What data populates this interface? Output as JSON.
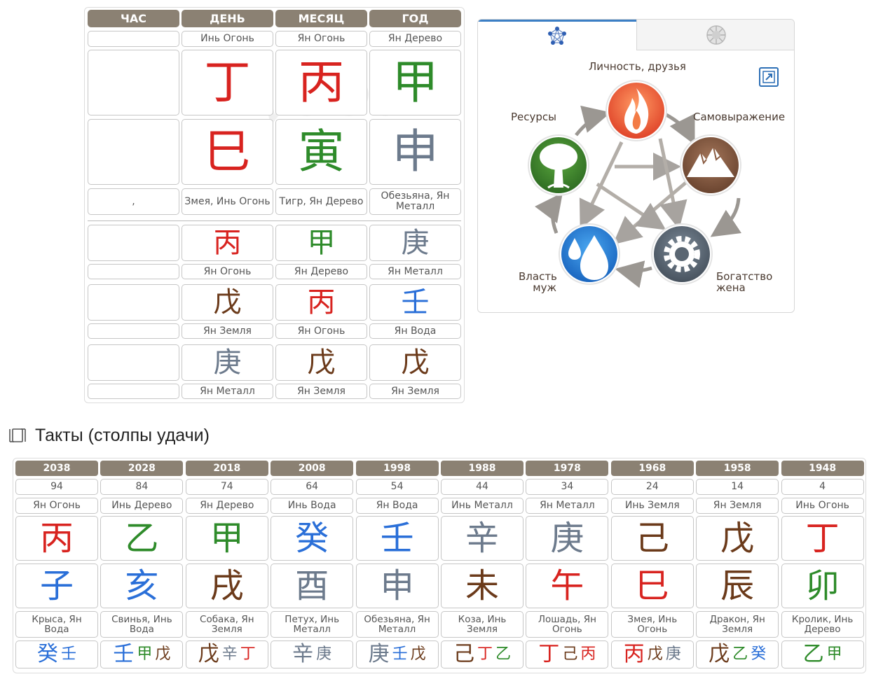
{
  "colors": {
    "fire": "#d8231f",
    "wood": "#2e8b2a",
    "earth": "#6b3a1a",
    "metal": "#6c7a8c",
    "water": "#2a6fd8",
    "header": "#8b8173"
  },
  "chart": {
    "headers": [
      "ЧАС",
      "ДЕНЬ",
      "МЕСЯЦ",
      "ГОД"
    ],
    "columns": [
      {
        "stem_label": "",
        "stem": "",
        "stem_el": "",
        "branch": "",
        "branch_el": "",
        "branch_label": ",",
        "hidden": [
          {
            "char": "",
            "el": "",
            "label": ""
          },
          {
            "char": "",
            "el": "",
            "label": ""
          },
          {
            "char": "",
            "el": "",
            "label": ""
          }
        ]
      },
      {
        "stem_label": "Инь Огонь",
        "stem": "丁",
        "stem_el": "fire",
        "branch": "巳",
        "branch_el": "fire",
        "branch_label": "Змея, Инь Огонь",
        "hidden": [
          {
            "char": "丙",
            "el": "fire",
            "label": "Ян Огонь"
          },
          {
            "char": "戊",
            "el": "earth",
            "label": "Ян Земля"
          },
          {
            "char": "庚",
            "el": "metal",
            "label": "Ян Металл"
          }
        ]
      },
      {
        "stem_label": "Ян Огонь",
        "stem": "丙",
        "stem_el": "fire",
        "branch": "寅",
        "branch_el": "wood",
        "branch_label": "Тигр, Ян Дерево",
        "hidden": [
          {
            "char": "甲",
            "el": "wood",
            "label": "Ян Дерево"
          },
          {
            "char": "丙",
            "el": "fire",
            "label": "Ян Огонь"
          },
          {
            "char": "戊",
            "el": "earth",
            "label": "Ян Земля"
          }
        ]
      },
      {
        "stem_label": "Ян Дерево",
        "stem": "甲",
        "stem_el": "wood",
        "branch": "申",
        "branch_el": "metal",
        "branch_label": "Обезьяна, Ян Металл",
        "hidden": [
          {
            "char": "庚",
            "el": "metal",
            "label": "Ян Металл"
          },
          {
            "char": "壬",
            "el": "water",
            "label": "Ян Вода"
          },
          {
            "char": "戊",
            "el": "earth",
            "label": "Ян Земля"
          }
        ]
      }
    ]
  },
  "diagram": {
    "labels": {
      "top": "Личность, друзья",
      "right": "Самовыражение",
      "left": "Ресурсы",
      "bottom_left_1": "Власть",
      "bottom_left_2": "муж",
      "bottom_right_1": "Богатство",
      "bottom_right_2": "жена"
    },
    "icons": {
      "tab_a": "pentagon-network-icon",
      "tab_b": "circle-diagram-icon",
      "expand": "expand-icon",
      "fire": "fire-icon",
      "earth": "mountain-icon",
      "metal": "gear-icon",
      "water": "water-drops-icon",
      "wood": "tree-icon"
    }
  },
  "section": {
    "title": "Такты (столпы удачи)",
    "icon": "pillars-toggle-icon"
  },
  "luck": {
    "pillars": [
      {
        "year": "2038",
        "age": "94",
        "stem_label": "Ян Огонь",
        "stem": "丙",
        "stem_el": "fire",
        "branch": "子",
        "branch_el": "water",
        "branch_label": "Крыса, Ян Вода",
        "hidden": [
          {
            "c": "癸",
            "el": "water"
          },
          {
            "c": "壬",
            "el": "water"
          }
        ]
      },
      {
        "year": "2028",
        "age": "84",
        "stem_label": "Инь Дерево",
        "stem": "乙",
        "stem_el": "wood",
        "branch": "亥",
        "branch_el": "water",
        "branch_label": "Свинья, Инь Вода",
        "hidden": [
          {
            "c": "壬",
            "el": "water"
          },
          {
            "c": "甲",
            "el": "wood"
          },
          {
            "c": "戊",
            "el": "earth"
          }
        ]
      },
      {
        "year": "2018",
        "age": "74",
        "stem_label": "Ян Дерево",
        "stem": "甲",
        "stem_el": "wood",
        "branch": "戌",
        "branch_el": "earth",
        "branch_label": "Собака, Ян Земля",
        "hidden": [
          {
            "c": "戊",
            "el": "earth"
          },
          {
            "c": "辛",
            "el": "metal"
          },
          {
            "c": "丁",
            "el": "fire"
          }
        ]
      },
      {
        "year": "2008",
        "age": "64",
        "stem_label": "Инь Вода",
        "stem": "癸",
        "stem_el": "water",
        "branch": "酉",
        "branch_el": "metal",
        "branch_label": "Петух, Инь Металл",
        "hidden": [
          {
            "c": "辛",
            "el": "metal"
          },
          {
            "c": "庚",
            "el": "metal"
          }
        ]
      },
      {
        "year": "1998",
        "age": "54",
        "stem_label": "Ян Вода",
        "stem": "壬",
        "stem_el": "water",
        "branch": "申",
        "branch_el": "metal",
        "branch_label": "Обезьяна, Ян Металл",
        "hidden": [
          {
            "c": "庚",
            "el": "metal"
          },
          {
            "c": "壬",
            "el": "water"
          },
          {
            "c": "戊",
            "el": "earth"
          }
        ]
      },
      {
        "year": "1988",
        "age": "44",
        "stem_label": "Инь Металл",
        "stem": "辛",
        "stem_el": "metal",
        "branch": "未",
        "branch_el": "earth",
        "branch_label": "Коза, Инь Земля",
        "hidden": [
          {
            "c": "己",
            "el": "earth"
          },
          {
            "c": "丁",
            "el": "fire"
          },
          {
            "c": "乙",
            "el": "wood"
          }
        ]
      },
      {
        "year": "1978",
        "age": "34",
        "stem_label": "Ян Металл",
        "stem": "庚",
        "stem_el": "metal",
        "branch": "午",
        "branch_el": "fire",
        "branch_label": "Лошадь, Ян Огонь",
        "hidden": [
          {
            "c": "丁",
            "el": "fire"
          },
          {
            "c": "己",
            "el": "earth"
          },
          {
            "c": "丙",
            "el": "fire"
          }
        ]
      },
      {
        "year": "1968",
        "age": "24",
        "stem_label": "Инь Земля",
        "stem": "己",
        "stem_el": "earth",
        "branch": "巳",
        "branch_el": "fire",
        "branch_label": "Змея, Инь Огонь",
        "hidden": [
          {
            "c": "丙",
            "el": "fire"
          },
          {
            "c": "戊",
            "el": "earth"
          },
          {
            "c": "庚",
            "el": "metal"
          }
        ]
      },
      {
        "year": "1958",
        "age": "14",
        "stem_label": "Ян Земля",
        "stem": "戊",
        "stem_el": "earth",
        "branch": "辰",
        "branch_el": "earth",
        "branch_label": "Дракон, Ян Земля",
        "hidden": [
          {
            "c": "戊",
            "el": "earth"
          },
          {
            "c": "乙",
            "el": "wood"
          },
          {
            "c": "癸",
            "el": "water"
          }
        ]
      },
      {
        "year": "1948",
        "age": "4",
        "stem_label": "Инь Огонь",
        "stem": "丁",
        "stem_el": "fire",
        "branch": "卯",
        "branch_el": "wood",
        "branch_label": "Кролик, Инь Дерево",
        "hidden": [
          {
            "c": "乙",
            "el": "wood"
          },
          {
            "c": "甲",
            "el": "wood"
          }
        ]
      }
    ]
  }
}
